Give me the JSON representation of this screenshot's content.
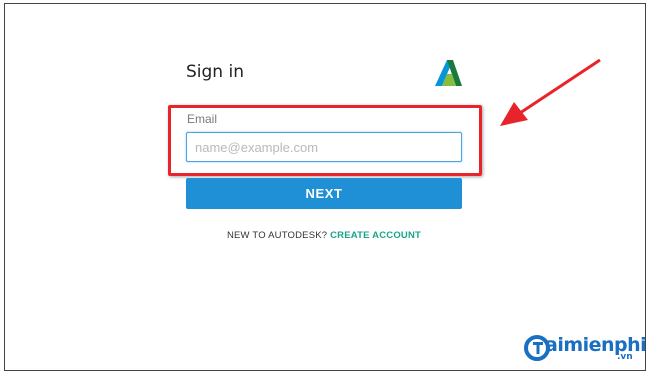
{
  "form": {
    "title": "Sign in",
    "email_label": "Email",
    "email_placeholder": "name@example.com",
    "email_value": "",
    "next_label": "NEXT",
    "new_text": "NEW TO AUTODESK?",
    "create_label": "CREATE ACCOUNT"
  },
  "watermark": {
    "text": "aimienphi",
    "suffix": ".vn"
  },
  "colors": {
    "accent_blue": "#1f8fd6",
    "link_green": "#1aa38a",
    "highlight_red": "#e8232a"
  },
  "icons": {
    "logo": "autodesk-logo-icon",
    "annotation": "red-arrow-icon"
  }
}
